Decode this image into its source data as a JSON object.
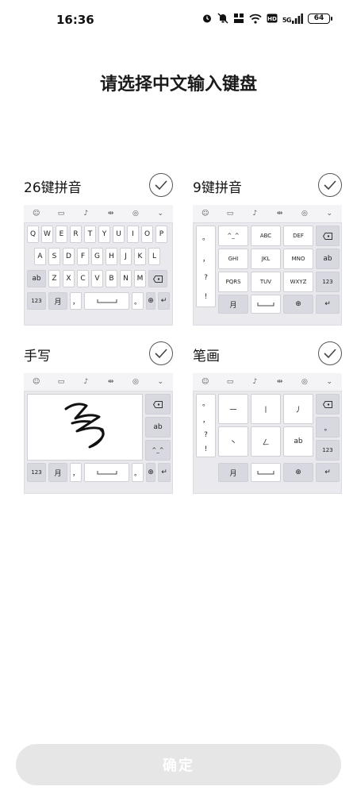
{
  "status": {
    "time": "16:36",
    "battery": "64",
    "signal_text": "5G"
  },
  "title": "请选择中文输入键盘",
  "options": [
    {
      "label": "26键拼音",
      "selected": false
    },
    {
      "label": "9键拼音",
      "selected": false
    },
    {
      "label": "手写",
      "selected": false
    },
    {
      "label": "笔画",
      "selected": false
    }
  ],
  "kb26": {
    "row1": [
      "Q",
      "W",
      "E",
      "R",
      "T",
      "Y",
      "U",
      "I",
      "O",
      "P"
    ],
    "row2": [
      "A",
      "S",
      "D",
      "F",
      "G",
      "H",
      "J",
      "K",
      "L"
    ],
    "row3": [
      "Z",
      "X",
      "C",
      "V",
      "B",
      "N",
      "M"
    ],
    "ab": "ab",
    "num": "123",
    "moon": "月",
    "comma": "，",
    "period": "。"
  },
  "kb9": {
    "side": [
      "。",
      "，",
      "?",
      "!"
    ],
    "keys": [
      "^_^",
      "ABC",
      "DEF",
      "GHI",
      "JKL",
      "MNO",
      "PQRS",
      "TUV",
      "WXYZ"
    ],
    "ab": "ab",
    "num": "123",
    "moon": "月"
  },
  "kbhw": {
    "ab": "ab",
    "emoticon": "^_^",
    "num": "123",
    "moon": "月",
    "comma": "，",
    "period": "。"
  },
  "kbbh": {
    "side": [
      "。",
      "，",
      "?",
      "!"
    ],
    "strokes": [
      "一",
      "丨",
      "丿",
      "丶",
      "ㄥ",
      "ab"
    ],
    "num": "123",
    "moon": "月",
    "period": "。"
  },
  "confirm_label": "确定",
  "colors": {
    "key_dark": "#d7d8e0",
    "key_light": "#ffffff",
    "confirm_bg": "#e6e6e6"
  }
}
